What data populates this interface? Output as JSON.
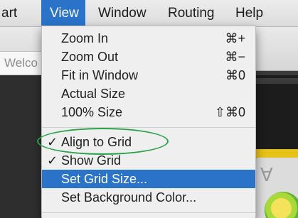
{
  "menubar": {
    "items": [
      {
        "label": "art"
      },
      {
        "label": "View"
      },
      {
        "label": "Window"
      },
      {
        "label": "Routing"
      },
      {
        "label": "Help"
      }
    ]
  },
  "background": {
    "welcome_text": "Welco"
  },
  "view_menu": {
    "items": [
      {
        "label": "Zoom In",
        "shortcut": "⌘+"
      },
      {
        "label": "Zoom Out",
        "shortcut": "⌘−"
      },
      {
        "label": "Fit in Window",
        "shortcut": "⌘0"
      },
      {
        "label": "Actual Size",
        "shortcut": ""
      },
      {
        "label": "100% Size",
        "shortcut": "⇧⌘0"
      },
      {
        "label": "Align to Grid",
        "checked": "✓"
      },
      {
        "label": "Show Grid",
        "checked": "✓"
      },
      {
        "label": "Set Grid Size...",
        "highlighted": true
      },
      {
        "label": "Set Background Color..."
      }
    ]
  },
  "colors": {
    "highlight": "#2a73c9",
    "annotation": "#2aa24a"
  }
}
